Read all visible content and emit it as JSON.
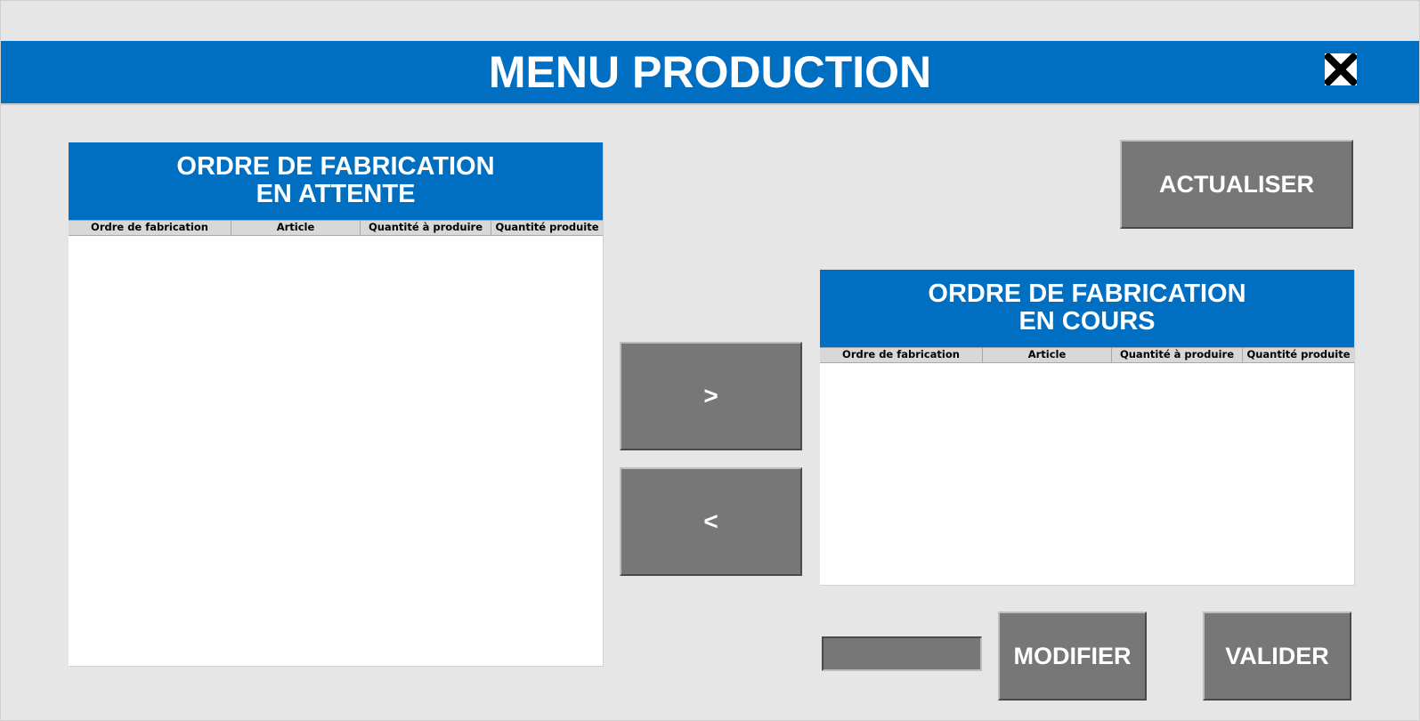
{
  "window": {
    "title": "MENU PRODUCTION",
    "close_icon": "close-icon"
  },
  "colors": {
    "header_blue": "#006fc1",
    "button_gray": "#777777",
    "background": "#e6e6e6"
  },
  "waiting_panel": {
    "title_line1": "ORDRE DE FABRICATION",
    "title_line2": "EN ATTENTE",
    "columns": [
      "Ordre de fabrication",
      "Article",
      "Quantité à produire",
      "Quantité produite"
    ],
    "rows": []
  },
  "in_progress_panel": {
    "title_line1": "ORDRE DE FABRICATION",
    "title_line2": "EN COURS",
    "columns": [
      "Ordre de fabrication",
      "Article",
      "Quantité à produire",
      "Quantité produite"
    ],
    "rows": []
  },
  "buttons": {
    "refresh": "ACTUALISER",
    "move_right": ">",
    "move_left": "<",
    "modify": "MODIFIER",
    "validate": "VALIDER"
  },
  "quantity_input": {
    "value": ""
  }
}
